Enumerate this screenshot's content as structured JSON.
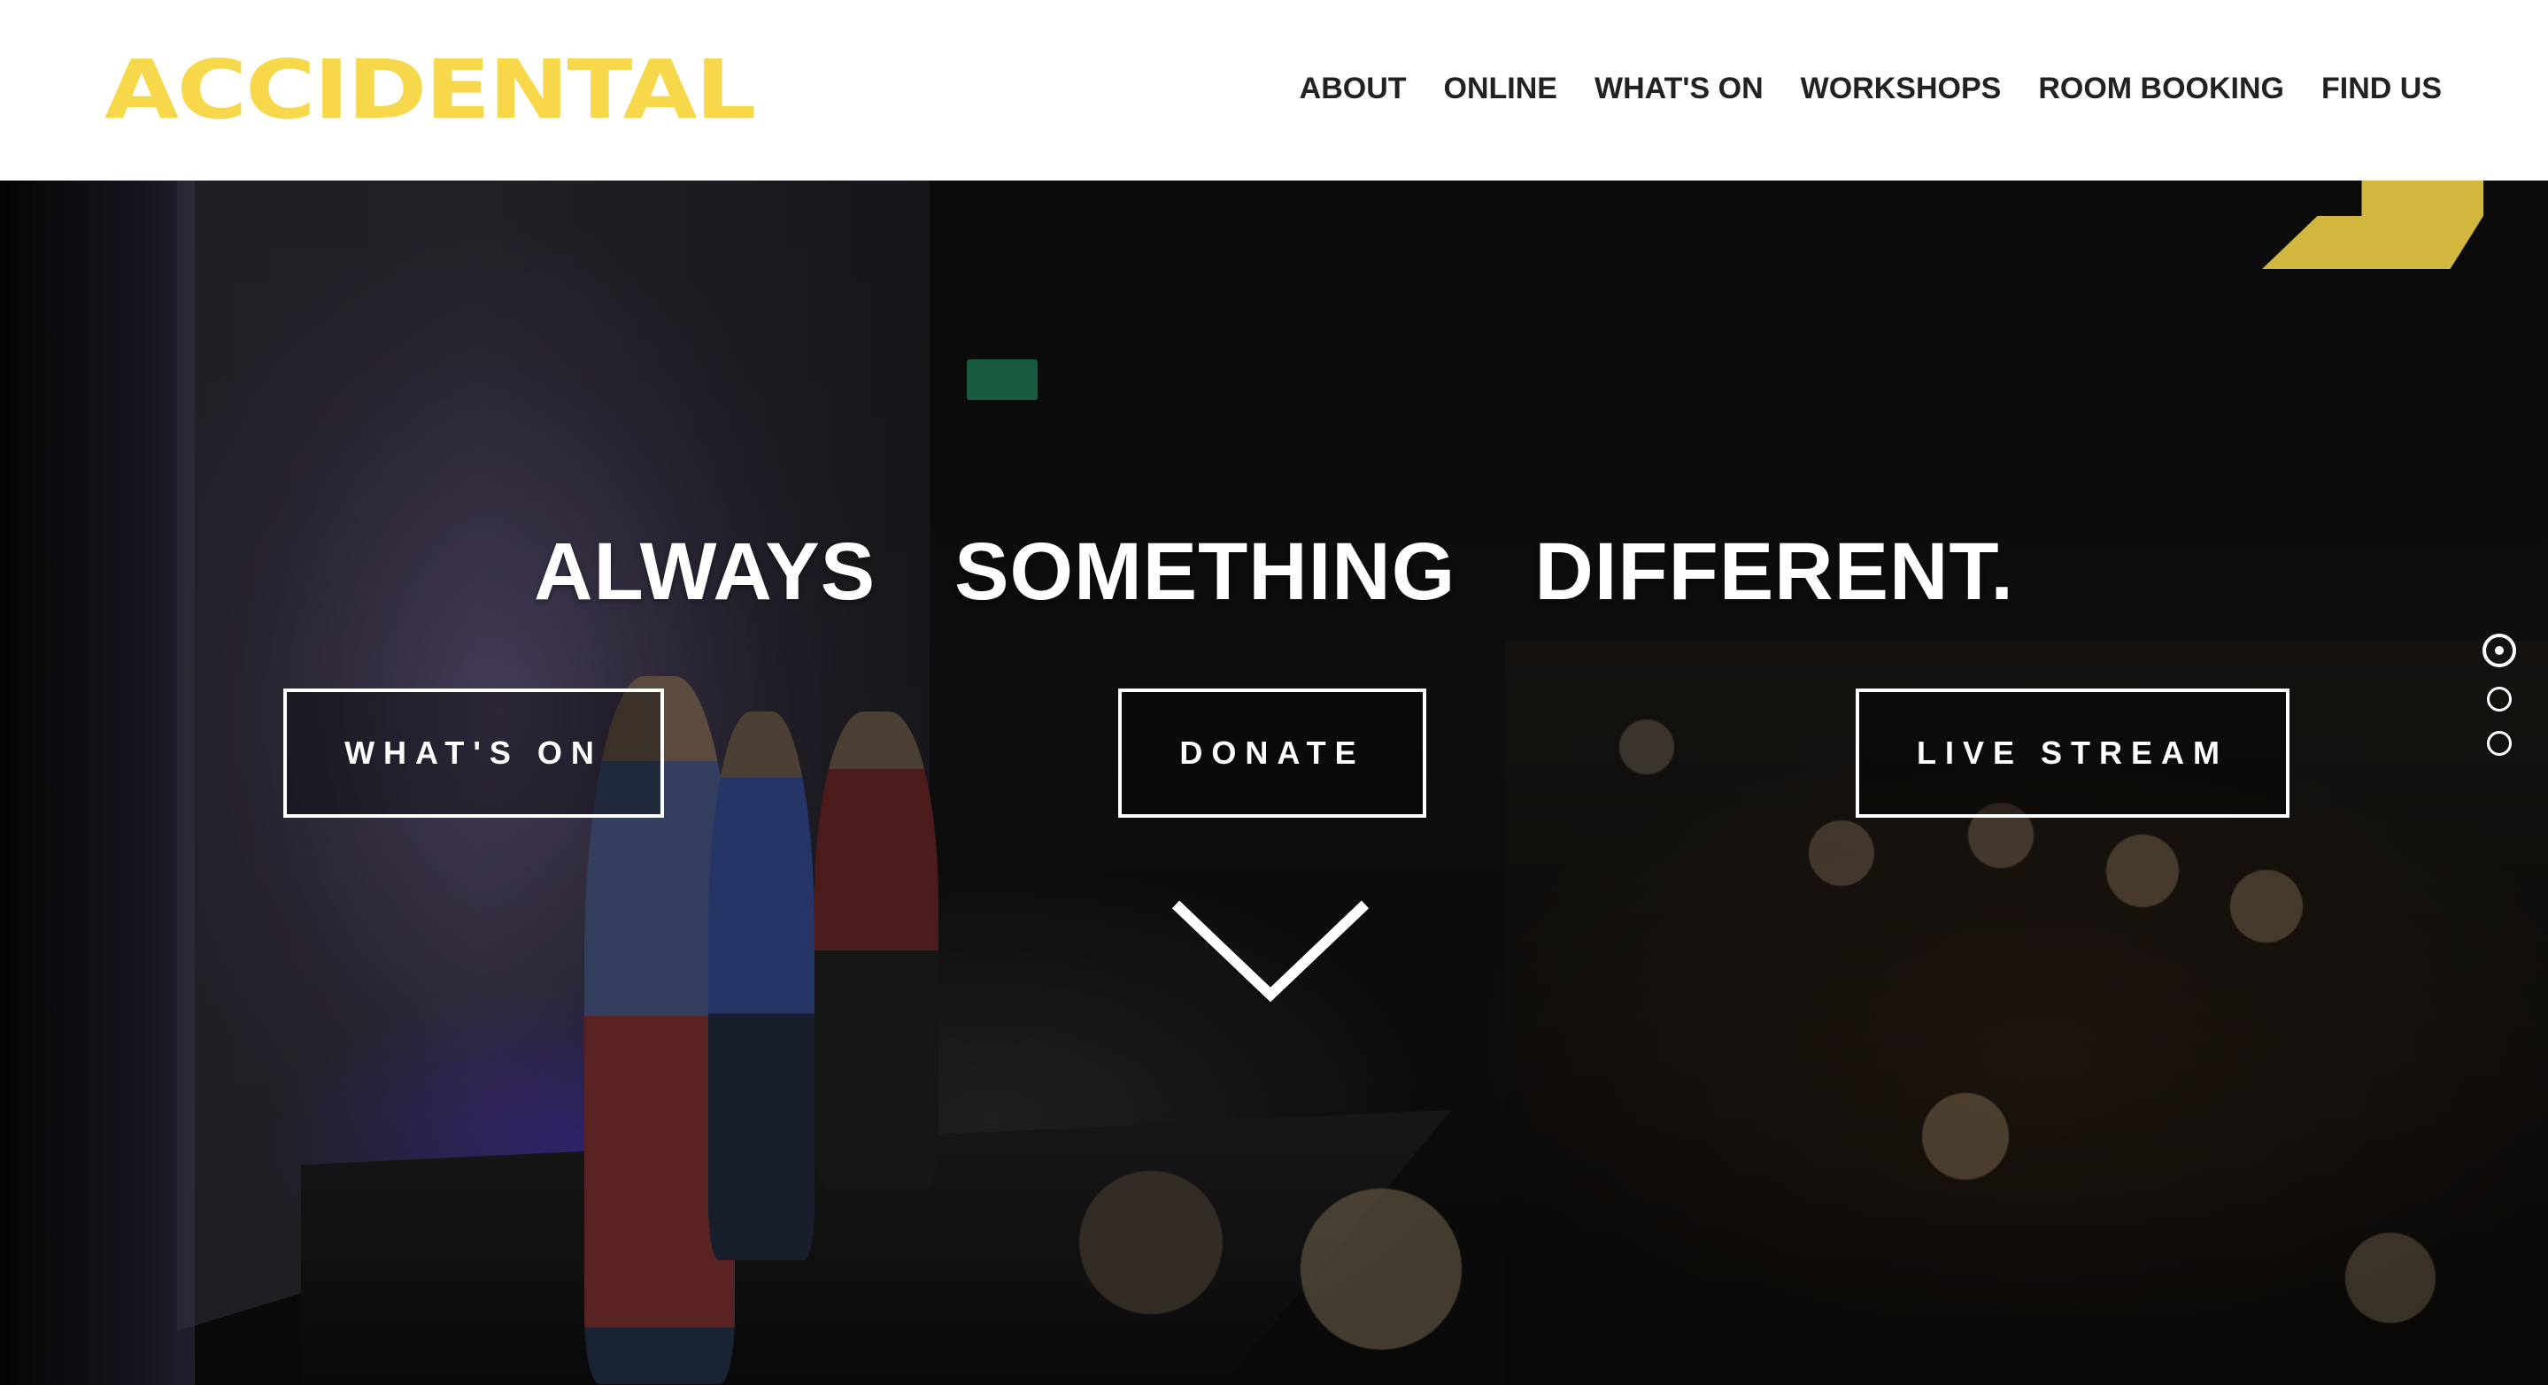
{
  "header": {
    "logo_text": "ACCIDENTAL",
    "brand_color": "#f7d84a",
    "nav": [
      {
        "label": "ABOUT"
      },
      {
        "label": "ONLINE"
      },
      {
        "label": "WHAT'S ON"
      },
      {
        "label": "WORKSHOPS"
      },
      {
        "label": "ROOM BOOKING"
      },
      {
        "label": "FIND US"
      }
    ]
  },
  "hero": {
    "tagline": "ALWAYS  SOMETHING  DIFFERENT.",
    "buttons": {
      "whats_on": "WHAT'S ON",
      "donate": "DONATE",
      "live_stream": "LIVE STREAM"
    },
    "scroll_icon": "chevron-down-icon",
    "slides": {
      "count": 3,
      "active_index": 0
    }
  }
}
